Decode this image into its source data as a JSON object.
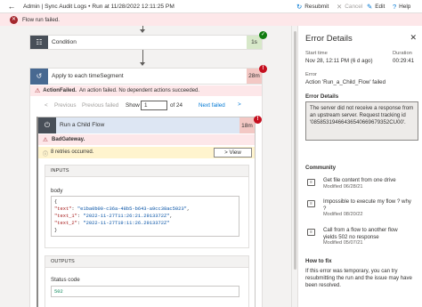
{
  "header": {
    "title": "Admin | Sync Audit Logs • Run at 11/28/2022 12:11:25 PM",
    "resubmit": "Resubmit",
    "cancel": "Cancel",
    "edit": "Edit",
    "help": "Help"
  },
  "banner": {
    "text": "Flow run failed."
  },
  "condition": {
    "label": "Condition",
    "duration": "1s"
  },
  "apply": {
    "label": "Apply to each timeSegment",
    "duration": "28m",
    "action_failed_bold": "ActionFailed.",
    "action_failed_text": "An action failed. No dependent actions succeeded.",
    "prev_all": "Previous failed",
    "prev": "Previous",
    "show_label": "Show",
    "page_value": "1",
    "page_total": "of 24",
    "next_failed": "Next failed",
    "next": "Next"
  },
  "child": {
    "label": "Run a Child Flow",
    "duration": "18m",
    "error_code": "BadGateway.",
    "retries": "8 retries occurred.",
    "view": "View",
    "inputs_header": "INPUTS",
    "body_label": "body",
    "code_lines": [
      "{",
      "  \"text\": \"e1ba0b00-c36a-48b5-b643-a9cc38ac5023\",",
      "  \"text_1\": \"2022-11-27T11:26:21.2913372Z\",",
      "  \"text_2\": \"2022-11-27T19:11:26.2913372Z\"",
      "}"
    ],
    "outputs_header": "OUTPUTS",
    "status_label": "Status code",
    "status_value": "502"
  },
  "panel": {
    "title": "Error Details",
    "start_label": "Start time",
    "start_value": "Nov 28, 12:11 PM (6 d ago)",
    "duration_label": "Duration",
    "duration_value": "00:29:41",
    "error_label": "Error",
    "error_value": "Action 'Run_a_Child_Flow' failed",
    "details_heading": "Error Details",
    "details_text": "The server did not receive a response from an upstream server. Request tracking id '08585319466436540669679352CU00'.",
    "community_heading": "Community",
    "community": [
      {
        "title": "Get file content from one drive",
        "date": "Modified 06/28/21"
      },
      {
        "title": "Impossible to execute my flow ? why ?",
        "date": "Modified 08/20/22"
      },
      {
        "title": "Call from a flow to another flow yields 502 no response",
        "date": "Modified 05/07/21"
      }
    ],
    "fix_heading": "How to fix",
    "fix_text": "If this error was temporary, you can try resubmitting the run and the issue may have been resolved."
  },
  "colors": {
    "accent": "#0078d4",
    "error": "#c50f1f",
    "success": "#107c10",
    "banner": "#fde7e9"
  }
}
